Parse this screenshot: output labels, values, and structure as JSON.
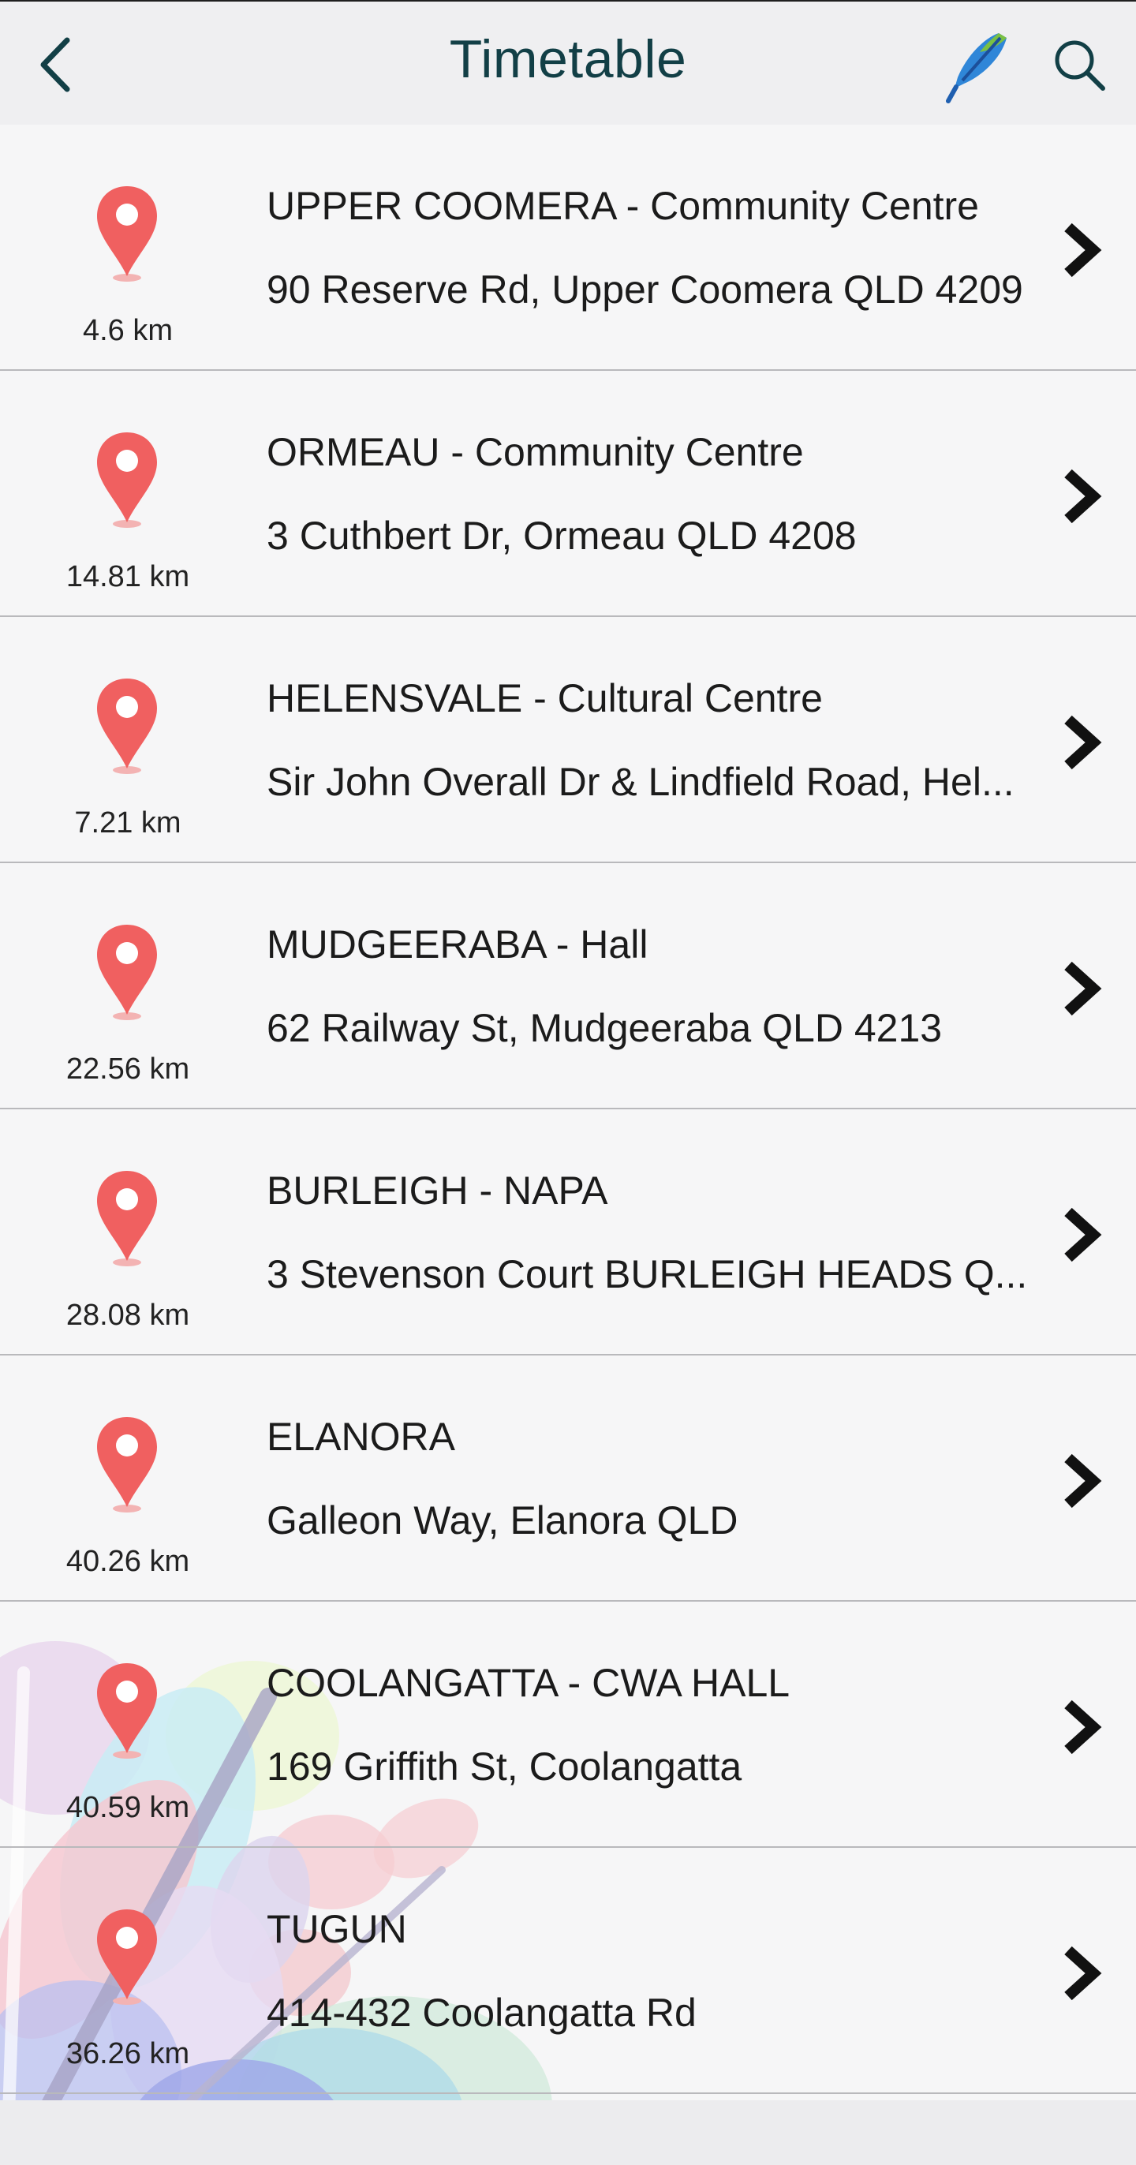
{
  "header": {
    "title": "Timetable",
    "back_icon": "chevron-left-icon",
    "feather_icon": "feather-icon",
    "search_icon": "search-icon"
  },
  "colors": {
    "pin": "#f06060",
    "title": "#123f46",
    "header_bg": "#efeff1"
  },
  "venues": [
    {
      "name": "UPPER COOMERA -  Community Centre",
      "address": "90 Reserve Rd, Upper Coomera QLD 4209",
      "distance": "4.6 km"
    },
    {
      "name": "ORMEAU - Community Centre",
      "address": "3 Cuthbert Dr, Ormeau QLD 4208",
      "distance": "14.81 km"
    },
    {
      "name": "HELENSVALE  - Cultural Centre",
      "address": "Sir John Overall Dr & Lindfield Road, Hel...",
      "distance": "7.21 km"
    },
    {
      "name": "MUDGEERABA - Hall",
      "address": "62 Railway St, Mudgeeraba QLD 4213",
      "distance": "22.56 km"
    },
    {
      "name": "BURLEIGH - NAPA",
      "address": "3 Stevenson Court BURLEIGH HEADS Q...",
      "distance": "28.08 km"
    },
    {
      "name": "ELANORA",
      "address": "Galleon Way, Elanora QLD",
      "distance": "40.26 km"
    },
    {
      "name": "COOLANGATTA - CWA HALL",
      "address": "169 Griffith St, Coolangatta",
      "distance": "40.59 km"
    },
    {
      "name": "TUGUN",
      "address": "414-432 Coolangatta Rd",
      "distance": "36.26 km"
    }
  ]
}
